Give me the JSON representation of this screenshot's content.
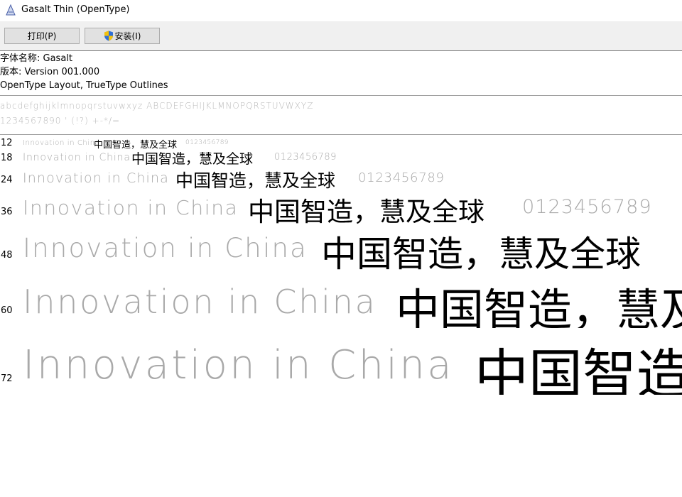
{
  "window": {
    "title": "Gasalt Thin (OpenType)"
  },
  "toolbar": {
    "print_label": "打印(P)",
    "install_label": "安装(I)"
  },
  "font_info": {
    "name_line": "字体名称: Gasalt",
    "version_line": "版本: Version 001.000",
    "format_line": "OpenType Layout, TrueType Outlines"
  },
  "charset": {
    "line1": "abcdefghijklmnopqrstuvwxyz ABCDEFGHIJKLMNOPQRSTUVWXYZ",
    "line2": "1234567890  ' (!?) +-*/="
  },
  "sample": {
    "latin": "Innovation in China",
    "cjk": "中国智造，慧及全球",
    "digits": "0123456789"
  },
  "sizes": [
    "12",
    "18",
    "24",
    "36",
    "48",
    "60",
    "72"
  ],
  "colors": {
    "toolbar_bg": "#f0f0f0",
    "button_bg": "#e1e1e1",
    "latin_text": "#a9a9a9"
  }
}
